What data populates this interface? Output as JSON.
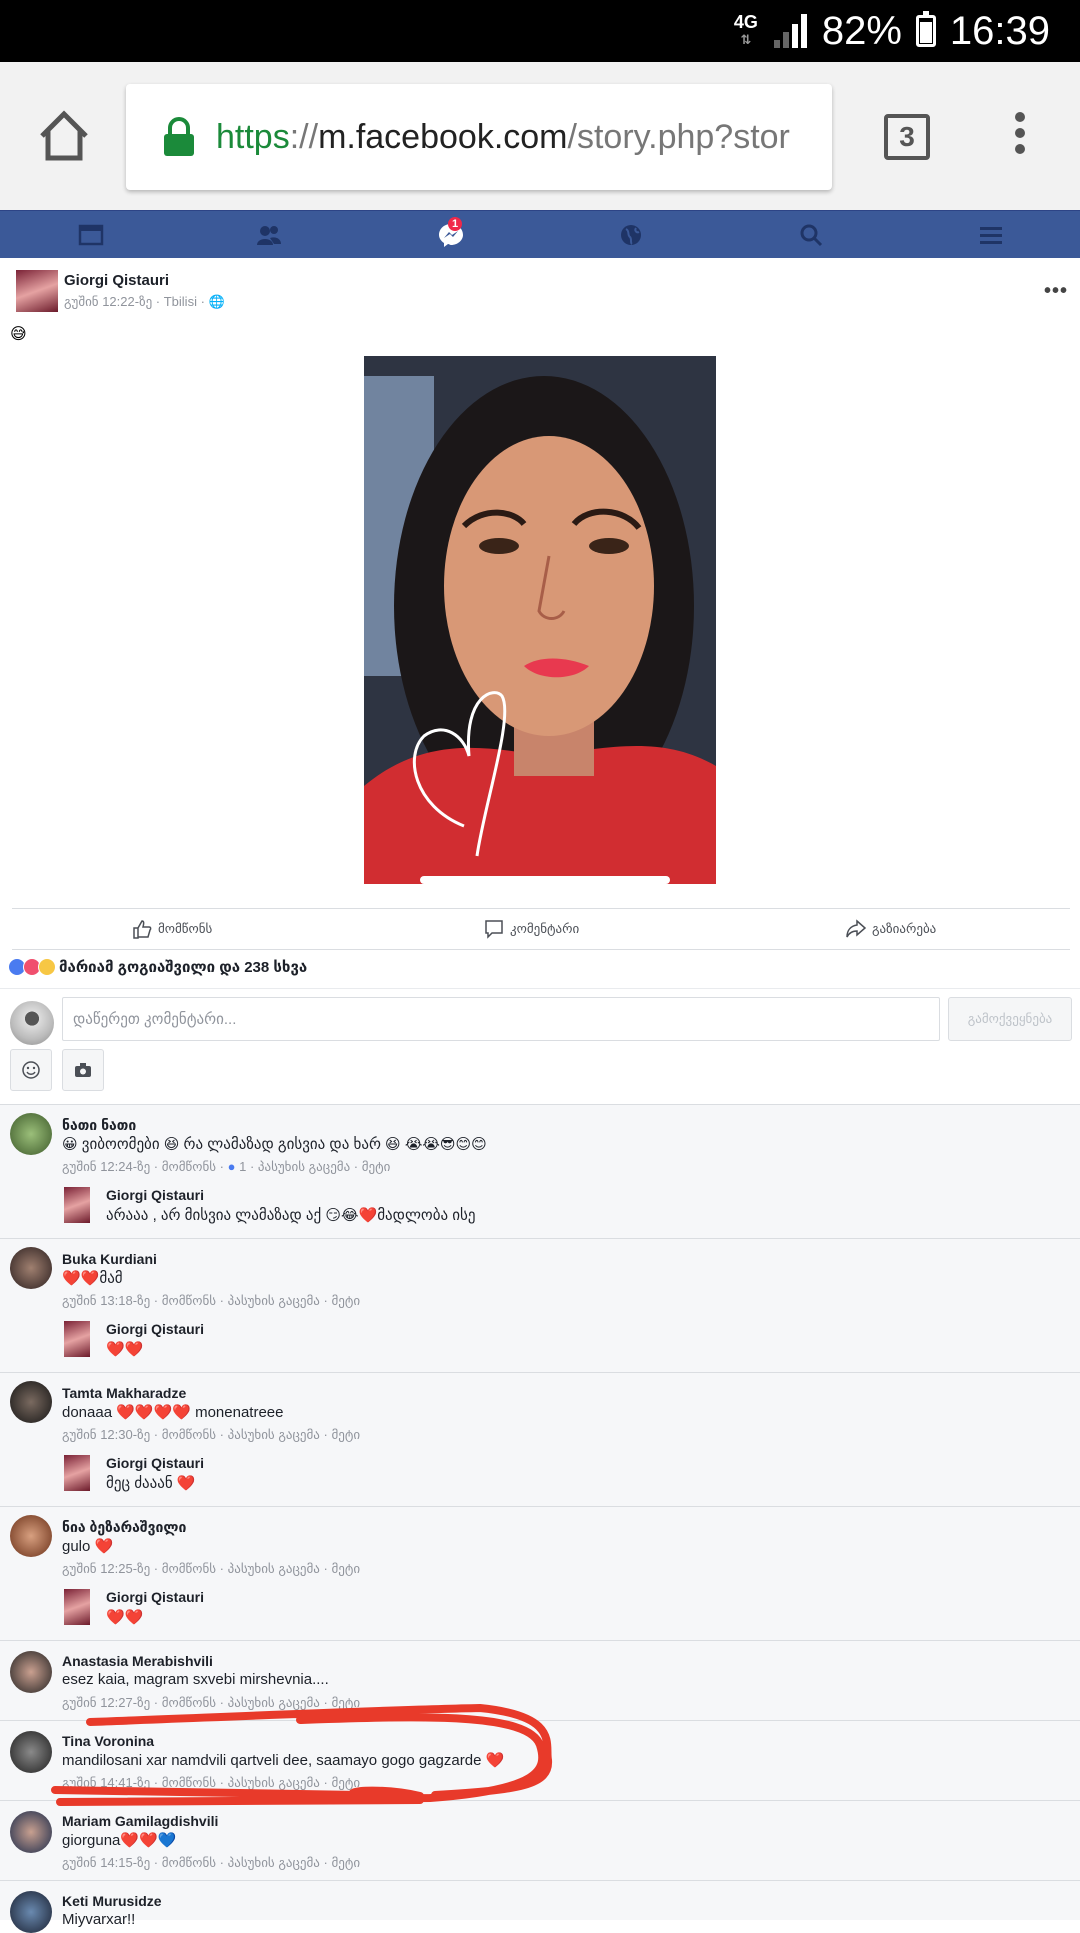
{
  "status_bar": {
    "network": "4G",
    "battery": "82%",
    "time": "16:39"
  },
  "browser": {
    "url_proto": "https",
    "url_sep": "://",
    "url_host": "m.facebook.com",
    "url_path": "/story.php?stor",
    "tab_count": "3"
  },
  "fb_nav": {
    "messages_badge": "1"
  },
  "post": {
    "author": "Giorgi Qistauri",
    "meta": "გუშინ 12:22-ზე · Tbilisi · ",
    "emoji": "😅",
    "actions": {
      "like": "მომწონს",
      "comment": "კომენტარი",
      "share": "გაზიარება"
    },
    "reactions_text": "მარიამ გოგიაშვილი და 238 სხვა"
  },
  "composer": {
    "placeholder": "დაწერეთ კომენტარი...",
    "post_button": "გამოქვეყნება"
  },
  "comments": [
    {
      "name": "ნათი ნათი",
      "text": "😀 ვიბოომები 😆 რა ლამაზად გისვია და ხარ 😆 😭😭😎😊😊",
      "meta": "გუშინ 12:24-ზე · მომწონს · ",
      "like_count": "1",
      "meta_tail": " · პასუხის გაცემა · მეტი",
      "reply": {
        "name": "Giorgi Qistauri",
        "text": "არააა , არ მისვია ლამაზად აქ 😏😂❤️მადლობა ისე"
      }
    },
    {
      "name": "Buka Kurdiani",
      "text": "❤️❤️მამ",
      "meta": "გუშინ 13:18-ზე · მომწონს · პასუხის გაცემა · მეტი",
      "reply": {
        "name": "Giorgi Qistauri",
        "text": "❤️❤️"
      }
    },
    {
      "name": "Tamta Makharadze",
      "text": "donaaa ❤️❤️❤️❤️ monenatreee",
      "meta": "გუშინ 12:30-ზე · მომწონს · პასუხის გაცემა · მეტი",
      "reply": {
        "name": "Giorgi Qistauri",
        "text": "მეც ძააან ❤️"
      }
    },
    {
      "name": "ნია ბეზარაშვილი",
      "text": "gulo ❤️",
      "meta": "გუშინ 12:25-ზე · მომწონს · პასუხის გაცემა · მეტი",
      "reply": {
        "name": "Giorgi Qistauri",
        "text": "❤️❤️"
      }
    },
    {
      "name": "Anastasia Merabishvili",
      "text": "esez kaia, magram sxvebi mirshevnia....",
      "meta": "გუშინ 12:27-ზე · მომწონს · პასუხის გაცემა · მეტი"
    },
    {
      "name": "Tina Voronina",
      "text": "mandilosani xar namdvili qartveli dee, saamayo gogo gagzarde ❤️",
      "meta": "გუშინ 14:41-ზე · მომწონს · პასუხის გაცემა · მეტი"
    },
    {
      "name": "Mariam Gamilagdishvili",
      "text": "giorguna❤️❤️💙",
      "meta": "გუშინ 14:15-ზე · მომწონს · პასუხის გაცემა · მეტი"
    },
    {
      "name": "Keti Murusidze",
      "text": "Miyvarxar!!"
    }
  ],
  "colors": {
    "fb_blue": "#3b5998",
    "annotation_red": "#e83a2a"
  }
}
